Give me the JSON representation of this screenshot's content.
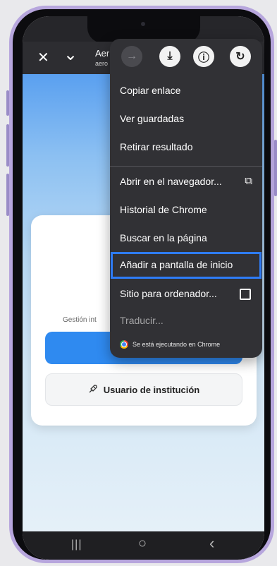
{
  "browser": {
    "close_glyph": "✕",
    "chevron_glyph": "⌄",
    "title": "Aer",
    "url": "aero"
  },
  "page": {
    "subtitle": "Gestión int",
    "secondary_button_label": "Usuario de institución",
    "secondary_button_icon": "rocket-icon"
  },
  "menu": {
    "top_icons": [
      {
        "name": "forward-icon",
        "glyph": "→"
      },
      {
        "name": "download-icon",
        "glyph": "⤓"
      },
      {
        "name": "info-icon",
        "glyph": "ⓘ"
      },
      {
        "name": "refresh-icon",
        "glyph": "↻"
      }
    ],
    "items": [
      {
        "label": "Copiar enlace"
      },
      {
        "label": "Ver guardadas"
      },
      {
        "label": "Retirar resultado"
      },
      {
        "label": "Abrir en el navegador...",
        "icon": "open-external-icon",
        "glyph": "⧉"
      },
      {
        "label": "Historial de Chrome"
      },
      {
        "label": "Buscar en la página"
      },
      {
        "label": "Añadir a pantalla de inicio",
        "highlighted": true
      },
      {
        "label": "Sitio para ordenador...",
        "icon": "checkbox-icon"
      },
      {
        "label": "Traducir..."
      }
    ],
    "footer": "Se está ejecutando en Chrome"
  },
  "navigation": {
    "recents_glyph": "|||",
    "home_glyph": "○",
    "back_glyph": "‹"
  },
  "colors": {
    "phone_frame": "#b7a6dd",
    "highlight": "#2e7cf6",
    "primary_button": "#2f8af0",
    "menu_bg": "#313135"
  }
}
